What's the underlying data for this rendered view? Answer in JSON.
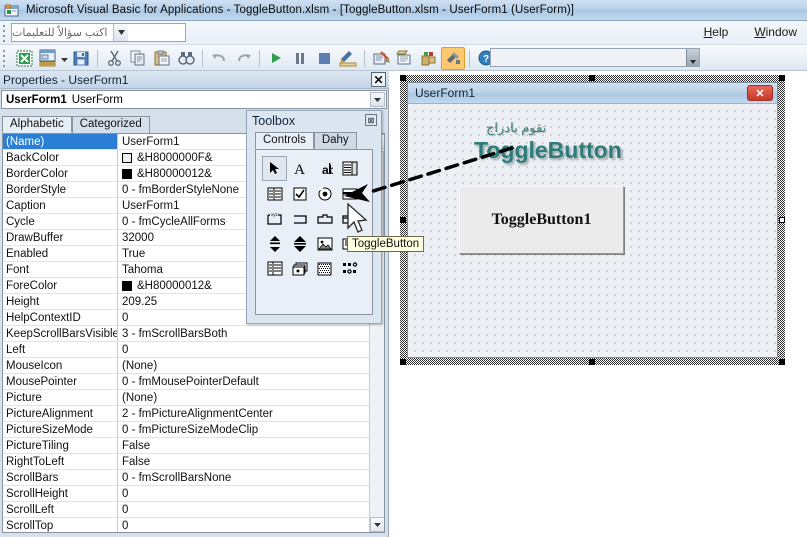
{
  "window": {
    "title": "Microsoft Visual Basic for Applications - ToggleButton.xlsm - [ToggleButton.xlsm - UserForm1 (UserForm)]",
    "app_icon": "vba-excel-icon"
  },
  "menubar": {
    "ask_placeholder": "اكتب سؤالاً للتعليمات",
    "items": [
      {
        "label": "Help",
        "accel": "H"
      },
      {
        "label": "Window",
        "accel": "W"
      }
    ]
  },
  "toolbar": {
    "buttons": [
      {
        "name": "view-excel",
        "glyph": "excel-icon"
      },
      {
        "name": "insert-userform",
        "glyph": "userform-icon"
      },
      {
        "name": "insert-dropdown",
        "glyph": "chevron-down-icon"
      },
      {
        "name": "save",
        "glyph": "save-icon"
      },
      {
        "name": "cut",
        "glyph": "scissors-icon"
      },
      {
        "name": "copy",
        "glyph": "copy-icon"
      },
      {
        "name": "paste",
        "glyph": "paste-icon"
      },
      {
        "name": "find",
        "glyph": "binoculars-icon"
      },
      {
        "name": "undo",
        "glyph": "undo-icon"
      },
      {
        "name": "redo",
        "glyph": "redo-icon"
      },
      {
        "name": "run",
        "glyph": "play-icon"
      },
      {
        "name": "break",
        "glyph": "pause-icon"
      },
      {
        "name": "reset",
        "glyph": "stop-icon"
      },
      {
        "name": "design-mode",
        "glyph": "design-mode-icon"
      },
      {
        "name": "project-explorer",
        "glyph": "project-explorer-icon"
      },
      {
        "name": "properties-window",
        "glyph": "properties-window-icon"
      },
      {
        "name": "object-browser",
        "glyph": "object-browser-icon"
      },
      {
        "name": "toolbox",
        "glyph": "toolbox-icon",
        "selected": true
      },
      {
        "name": "help",
        "glyph": "help-icon"
      }
    ],
    "combo_value": ""
  },
  "properties": {
    "title": "Properties - UserForm1",
    "close_label": "✕",
    "object_name": "UserForm1",
    "object_type": "UserForm",
    "tabs": [
      {
        "label": "Alphabetic",
        "active": true
      },
      {
        "label": "Categorized",
        "active": false
      }
    ],
    "rows": [
      {
        "key": "(Name)",
        "value": "UserForm1",
        "selected": true
      },
      {
        "key": "BackColor",
        "value": "&H8000000F&",
        "swatch": "#eceff3"
      },
      {
        "key": "BorderColor",
        "value": "&H80000012&",
        "swatch": "#000000"
      },
      {
        "key": "BorderStyle",
        "value": "0 - fmBorderStyleNone"
      },
      {
        "key": "Caption",
        "value": "UserForm1"
      },
      {
        "key": "Cycle",
        "value": "0 - fmCycleAllForms"
      },
      {
        "key": "DrawBuffer",
        "value": "32000"
      },
      {
        "key": "Enabled",
        "value": "True"
      },
      {
        "key": "Font",
        "value": "Tahoma"
      },
      {
        "key": "ForeColor",
        "value": "&H80000012&",
        "swatch": "#000000"
      },
      {
        "key": "Height",
        "value": "209.25"
      },
      {
        "key": "HelpContextID",
        "value": "0"
      },
      {
        "key": "KeepScrollBarsVisible",
        "value": "3 - fmScrollBarsBoth"
      },
      {
        "key": "Left",
        "value": "0"
      },
      {
        "key": "MouseIcon",
        "value": "(None)"
      },
      {
        "key": "MousePointer",
        "value": "0 - fmMousePointerDefault"
      },
      {
        "key": "Picture",
        "value": "(None)"
      },
      {
        "key": "PictureAlignment",
        "value": "2 - fmPictureAlignmentCenter"
      },
      {
        "key": "PictureSizeMode",
        "value": "0 - fmPictureSizeModeClip"
      },
      {
        "key": "PictureTiling",
        "value": "False"
      },
      {
        "key": "RightToLeft",
        "value": "False"
      },
      {
        "key": "ScrollBars",
        "value": "0 - fmScrollBarsNone"
      },
      {
        "key": "ScrollHeight",
        "value": "0"
      },
      {
        "key": "ScrollLeft",
        "value": "0"
      },
      {
        "key": "ScrollTop",
        "value": "0"
      }
    ]
  },
  "toolbox": {
    "title": "Toolbox",
    "close_label": "⊠",
    "tabs": [
      {
        "label": "Controls",
        "active": true
      },
      {
        "label": "Dahy",
        "active": false
      }
    ],
    "controls": [
      {
        "name": "select-objects-icon",
        "selected": false
      },
      {
        "name": "label-icon",
        "selected": false
      },
      {
        "name": "textbox-icon",
        "selected": false
      },
      {
        "name": "combobox-icon",
        "selected": false
      },
      {
        "name": "listbox-icon",
        "selected": false
      },
      {
        "name": "checkbox-icon",
        "selected": false
      },
      {
        "name": "optionbutton-icon",
        "selected": false
      },
      {
        "name": "togglebutton-icon",
        "selected": true
      },
      {
        "name": "frame-icon",
        "selected": false
      },
      {
        "name": "commandbutton-icon",
        "selected": false
      },
      {
        "name": "tabstrip-icon",
        "selected": false
      },
      {
        "name": "multipage-icon",
        "selected": false
      },
      {
        "name": "scrollbar-icon",
        "selected": false
      },
      {
        "name": "spinbutton-icon",
        "selected": false
      },
      {
        "name": "image-icon",
        "selected": false
      },
      {
        "name": "refedit-icon",
        "selected": false
      },
      {
        "name": "listview-icon",
        "selected": false
      },
      {
        "name": "cards-icon",
        "selected": false
      },
      {
        "name": "hatch-icon",
        "selected": false
      },
      {
        "name": "dots-icon",
        "selected": false
      }
    ],
    "tooltip": "ToggleButton"
  },
  "designer": {
    "form": {
      "caption": "UserForm1",
      "close_label": "✕",
      "labels": {
        "arabic": "نقوم بادراج",
        "english": "ToggleButton"
      },
      "toggle_button_caption": "ToggleButton1"
    }
  },
  "colors": {
    "titlebar": "#b9d2ea",
    "selection": "#2a7fd4",
    "toolbox_selected": "#ffc86e",
    "label_teal": "#2e7b78",
    "close_red": "#c5372b"
  }
}
